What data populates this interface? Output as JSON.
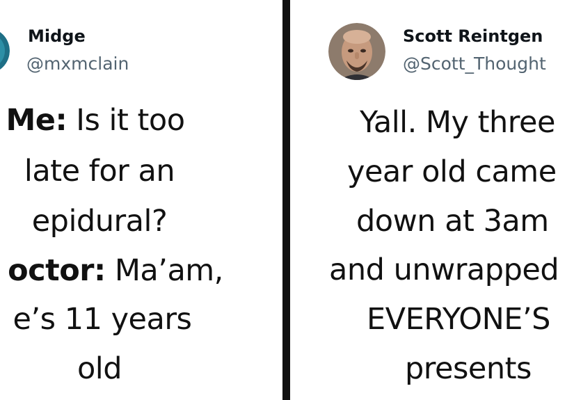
{
  "left_tweet": {
    "name": "Midge",
    "handle": "@mxmclain",
    "avatar_icon": "profile-avatar-icon",
    "lines": [
      {
        "speaker": "Me:",
        "text": " Is it too"
      },
      {
        "speaker": "",
        "text": "late for an"
      },
      {
        "speaker": "",
        "text": "epidural?"
      },
      {
        "speaker": "octor:",
        "text": " Ma’am,"
      },
      {
        "speaker": "",
        "text": "e’s 11 years"
      },
      {
        "speaker": "",
        "text": "old"
      }
    ]
  },
  "right_tweet": {
    "name": "Scott Reintgen",
    "handle": "@Scott_Thought",
    "avatar_icon": "profile-photo-icon",
    "lines": [
      {
        "text": "Yall. My three"
      },
      {
        "text": "year old came"
      },
      {
        "text": "down at 3am"
      },
      {
        "text": "and unwrapped"
      },
      {
        "text": "EVERYONE’S"
      },
      {
        "text": "presents"
      }
    ]
  },
  "colors": {
    "divider": "#111111",
    "handle": "#536471",
    "text": "#0f1419"
  }
}
